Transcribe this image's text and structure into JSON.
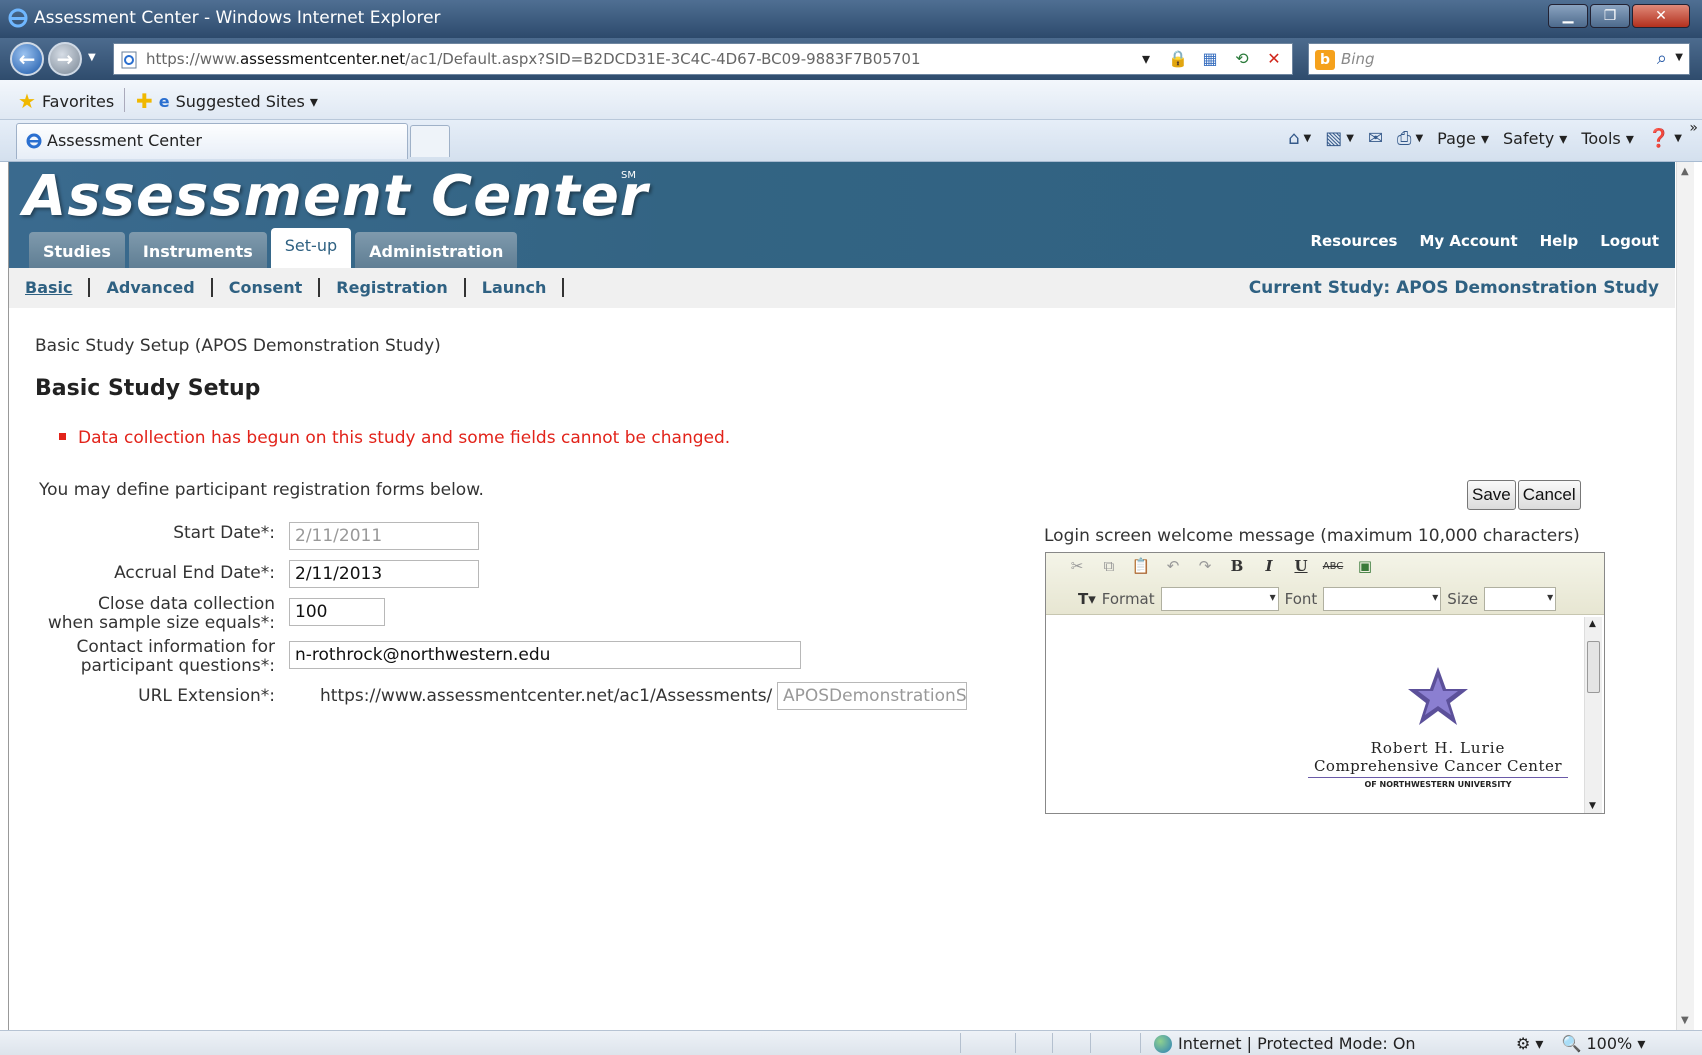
{
  "window": {
    "title": "Assessment Center - Windows Internet Explorer",
    "url_prefix": "https://www.",
    "url_host": "assessmentcenter.net",
    "url_path": "/ac1/Default.aspx?SID=B2DCD31E-3C4C-4D67-BC09-9883F7B05701",
    "search_placeholder": "Bing"
  },
  "favorites_bar": {
    "favorites_label": "Favorites",
    "suggested_label": "Suggested Sites ▾"
  },
  "tabs": [
    {
      "label": "Assessment Center"
    }
  ],
  "command_bar": {
    "page": "Page",
    "safety": "Safety",
    "tools": "Tools"
  },
  "app": {
    "logo": "Assessment Center",
    "sm_mark": "SM",
    "main_tabs": [
      {
        "label": "Studies",
        "active": false
      },
      {
        "label": "Instruments",
        "active": false
      },
      {
        "label": "Set-up",
        "active": true
      },
      {
        "label": "Administration",
        "active": false
      }
    ],
    "top_links": [
      "Resources",
      "My Account",
      "Help",
      "Logout"
    ],
    "sub_nav": [
      "Basic",
      "Advanced",
      "Consent",
      "Registration",
      "Launch"
    ],
    "current_study": "Current Study: APOS Demonstration Study"
  },
  "page": {
    "breadcrumb": "Basic Study Setup (APOS Demonstration Study)",
    "heading": "Basic Study Setup",
    "error_message": "Data collection has begun on this study and some fields cannot be changed.",
    "intro": "You may define participant registration forms below.",
    "save_label": "Save",
    "cancel_label": "Cancel",
    "fields": {
      "start_date_label": "Start Date*:",
      "start_date_value": "2/11/2011",
      "accrual_end_label": "Accrual End Date*:",
      "accrual_end_value": "2/11/2013",
      "close_label_1": "Close data collection",
      "close_label_2": "when sample size equals*:",
      "close_value": "100",
      "contact_label_1": "Contact information for",
      "contact_label_2": "participant questions*:",
      "contact_value": "n-rothrock@northwestern.edu",
      "url_ext_label": "URL Extension*:",
      "url_ext_prefix": "https://www.assessmentcenter.net/ac1/Assessments/",
      "url_ext_value": "APOSDemonstrationSt"
    },
    "welcome": {
      "label": "Login screen welcome message (maximum 10,000 characters)",
      "format_label": "Format",
      "font_label": "Font",
      "size_label": "Size",
      "logo_line1": "Robert H. Lurie",
      "logo_line2": "Comprehensive Cancer Center",
      "logo_line3": "OF NORTHWESTERN UNIVERSITY"
    }
  },
  "status_bar": {
    "zone": "Internet | Protected Mode: On",
    "zoom": "100%"
  }
}
